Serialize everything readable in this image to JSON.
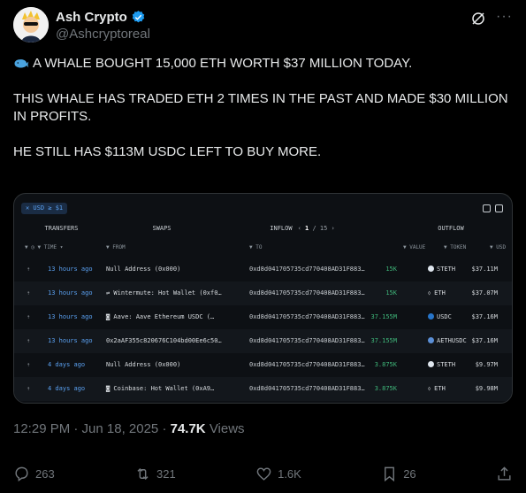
{
  "author": {
    "name": "Ash Crypto",
    "handle": "@Ashcryptoreal"
  },
  "post": {
    "line1": "A WHALE BOUGHT 15,000 ETH WORTH $37 MILLION TODAY.",
    "line2": "THIS WHALE HAS TRADED ETH 2 TIMES IN THE PAST AND MADE $30 MILLION IN PROFITS.",
    "line3": "HE STILL HAS $113M USDC LEFT TO BUY MORE."
  },
  "table": {
    "filter_chip": "✕ USD ≥ $1",
    "tabs": {
      "transfers": "TRANSFERS",
      "swaps": "SWAPS",
      "inflow": "INFLOW",
      "page_current": "1",
      "page_total": "/ 15",
      "outflow": "OUTFLOW"
    },
    "columns": {
      "time": "▼ ◷ ▼ TIME ▾",
      "from": "▼ FROM",
      "to": "▼ TO",
      "value": "▼ VALUE",
      "token": "▼ TOKEN",
      "usd": "▼ USD"
    },
    "rows": [
      {
        "time": "13 hours ago",
        "from": "Null Address (0x000)",
        "to": "0xd8d041705735cd770408AD31F883…",
        "value": "15K",
        "token": "STETH",
        "usd": "$37.11M",
        "token_color": "#dfe6ee"
      },
      {
        "time": "13 hours ago",
        "from": "⇌ Wintermute: Hot Wallet (0xf0…",
        "to": "0xd8d041705735cd770408AD31F883…",
        "value": "15K",
        "token": "ETH",
        "usd": "$37.07M",
        "token_color": ""
      },
      {
        "time": "13 hours ago",
        "from": "◙ Aave: Aave Ethereum USDC (…",
        "to": "0xd8d041705735cd770408AD31F883…",
        "value": "37.155M",
        "token": "USDC",
        "usd": "$37.16M",
        "token_color": "#2775ca"
      },
      {
        "time": "13 hours ago",
        "from": "0x2aAF355c820676C104bd00Ee6c50…",
        "to": "0xd8d041705735cd770408AD31F883…",
        "value": "37.155M",
        "token": "AETHUSDC",
        "usd": "$37.16M",
        "token_color": "#5b8fd6"
      },
      {
        "time": "4 days ago",
        "from": "Null Address (0x000)",
        "to": "0xd8d041705735cd770408AD31F883…",
        "value": "3.875K",
        "token": "STETH",
        "usd": "$9.97M",
        "token_color": "#dfe6ee"
      },
      {
        "time": "4 days ago",
        "from": "◙ Coinbase: Hot Wallet (0xA9…",
        "to": "0xd8d041705735cd770408AD31F883…",
        "value": "3.875K",
        "token": "ETH",
        "usd": "$9.98M",
        "token_color": ""
      }
    ]
  },
  "meta": {
    "time": "12:29 PM · Jun 18, 2025 ·",
    "views_count": "74.7K",
    "views_label": "Views"
  },
  "actions": {
    "replies": "263",
    "reposts": "321",
    "likes": "1.6K",
    "bookmarks": "26"
  },
  "colors": {
    "background": "#000000",
    "text": "#e7e9ea",
    "muted": "#71767b",
    "verified": "#1d9bf0",
    "link_blue": "#5aa0f0",
    "value_green": "#3fb77a"
  }
}
